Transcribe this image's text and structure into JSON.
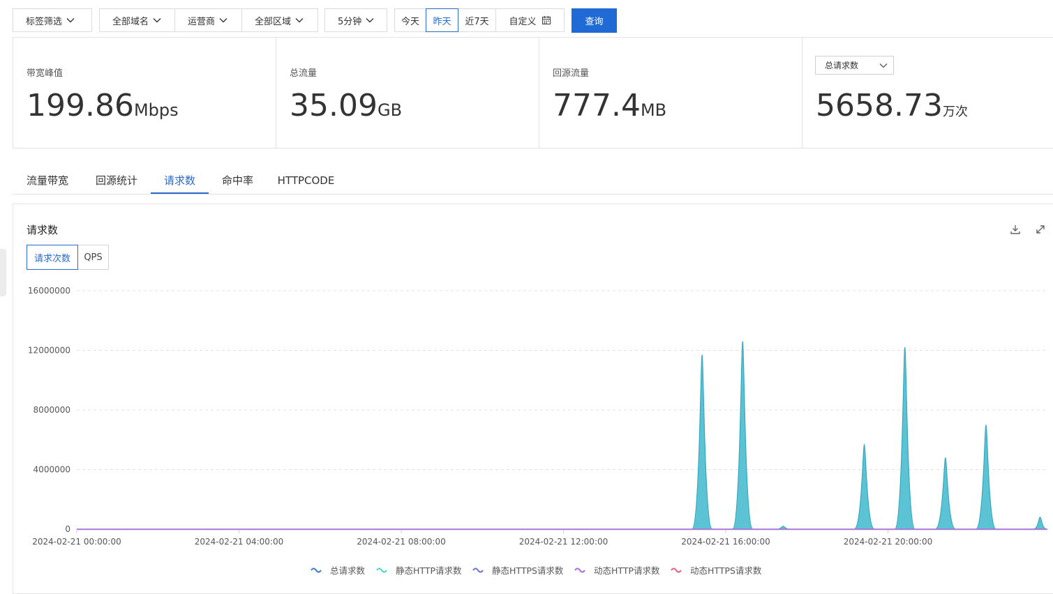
{
  "toolbar": {
    "tag_filter": "标签筛选",
    "domain": "全部域名",
    "isp": "运营商",
    "region": "全部区域",
    "interval": "5分钟",
    "date_buttons": [
      "今天",
      "昨天",
      "近7天"
    ],
    "active_date": "昨天",
    "custom": "自定义",
    "query": "查询"
  },
  "stats": {
    "bandwidth": {
      "label": "带宽峰值",
      "value": "199.86",
      "unit": "Mbps"
    },
    "total_traffic": {
      "label": "总流量",
      "value": "35.09",
      "unit": "GB"
    },
    "origin_traffic": {
      "label": "回源流量",
      "value": "777.4",
      "unit": "MB"
    },
    "requests": {
      "select": "总请求数",
      "value": "5658.73",
      "unit": "万次"
    }
  },
  "tabs": [
    "流量带宽",
    "回源统计",
    "请求数",
    "命中率",
    "HTTPCODE"
  ],
  "active_tab": "请求数",
  "panel": {
    "title": "请求数",
    "toggle": [
      "请求次数",
      "QPS"
    ],
    "active_toggle": "请求次数"
  },
  "colors": {
    "accent": "#1f6ad4",
    "spike_fill": "#5bc3d3",
    "spike_stroke": "#36a9c0",
    "baseline": "#b36ae0"
  },
  "chart_data": {
    "type": "area",
    "title": "",
    "xlabel": "",
    "ylabel": "",
    "x_range": [
      "2024-02-21 00:00:00",
      "2024-02-21 23:55:00"
    ],
    "x_ticks": [
      "2024-02-21 00:00:00",
      "2024-02-21 04:00:00",
      "2024-02-21 08:00:00",
      "2024-02-21 12:00:00",
      "2024-02-21 16:00:00",
      "2024-02-21 20:00:00"
    ],
    "y_ticks": [
      0,
      4000000,
      8000000,
      12000000,
      16000000
    ],
    "ylim": [
      0,
      16000000
    ],
    "grid": true,
    "legend_position": "bottom",
    "series": [
      {
        "name": "总请求数",
        "color": "#3d7cc9",
        "points": [
          {
            "x": "2024-02-21 00:00:00",
            "y": 0
          },
          {
            "x": "2024-02-21 15:10:00",
            "y": 0
          },
          {
            "x": "2024-02-21 15:25:00",
            "y": 11700000
          },
          {
            "x": "2024-02-21 15:40:00",
            "y": 0
          },
          {
            "x": "2024-02-21 16:10:00",
            "y": 0
          },
          {
            "x": "2024-02-21 16:25:00",
            "y": 12600000
          },
          {
            "x": "2024-02-21 16:40:00",
            "y": 0
          },
          {
            "x": "2024-02-21 17:15:00",
            "y": 0
          },
          {
            "x": "2024-02-21 17:25:00",
            "y": 200000
          },
          {
            "x": "2024-02-21 17:35:00",
            "y": 0
          },
          {
            "x": "2024-02-21 19:10:00",
            "y": 0
          },
          {
            "x": "2024-02-21 19:25:00",
            "y": 5700000
          },
          {
            "x": "2024-02-21 19:40:00",
            "y": 0
          },
          {
            "x": "2024-02-21 20:10:00",
            "y": 0
          },
          {
            "x": "2024-02-21 20:25:00",
            "y": 12200000
          },
          {
            "x": "2024-02-21 20:40:00",
            "y": 0
          },
          {
            "x": "2024-02-21 21:10:00",
            "y": 0
          },
          {
            "x": "2024-02-21 21:25:00",
            "y": 4800000
          },
          {
            "x": "2024-02-21 21:40:00",
            "y": 0
          },
          {
            "x": "2024-02-21 22:10:00",
            "y": 0
          },
          {
            "x": "2024-02-21 22:25:00",
            "y": 7000000
          },
          {
            "x": "2024-02-21 22:40:00",
            "y": 0
          },
          {
            "x": "2024-02-21 23:35:00",
            "y": 0
          },
          {
            "x": "2024-02-21 23:45:00",
            "y": 800000
          },
          {
            "x": "2024-02-21 23:55:00",
            "y": 0
          }
        ]
      },
      {
        "name": "静态HTTP请求数",
        "color": "#4fd6c8",
        "points": []
      },
      {
        "name": "静态HTTPS请求数",
        "color": "#6b74d8",
        "points": []
      },
      {
        "name": "动态HTTP请求数",
        "color": "#b36ae0",
        "points": []
      },
      {
        "name": "动态HTTPS请求数",
        "color": "#e8607a",
        "points": []
      }
    ]
  }
}
